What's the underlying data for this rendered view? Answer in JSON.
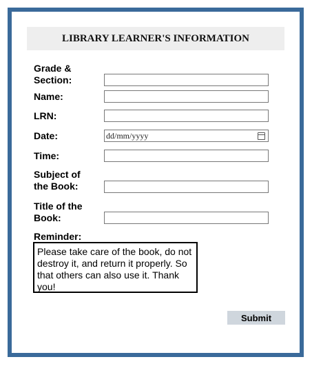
{
  "form": {
    "title": "LIBRARY LEARNER'S INFORMATION",
    "fields": {
      "grade_section": {
        "label": "Grade & Section:",
        "value": ""
      },
      "name": {
        "label": "Name:",
        "value": ""
      },
      "lrn": {
        "label": "LRN:",
        "value": ""
      },
      "date": {
        "label": "Date:",
        "value": "dd/mm/yyyy"
      },
      "time": {
        "label": "Time:",
        "value": ""
      },
      "subject": {
        "label": "Subject of the Book:",
        "value": ""
      },
      "title_of_book": {
        "label": "Title of the Book:",
        "value": ""
      }
    },
    "reminder": {
      "label": "Reminder:",
      "text": "Please take care of the book, do not destroy it, and return it properly. So that others can also use it. Thank you!"
    },
    "submit_label": "Submit"
  },
  "colors": {
    "frame_border": "#3a6a9a",
    "header_background": "#eeeeee",
    "submit_background": "#cfd6dd"
  }
}
